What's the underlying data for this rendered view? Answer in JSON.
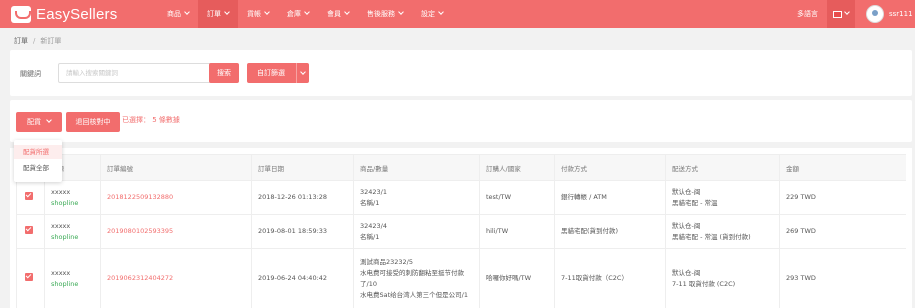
{
  "brand": {
    "name": "EasySellers",
    "accent": "#f26d6d"
  },
  "nav": {
    "items": [
      {
        "label": "商品",
        "active": false
      },
      {
        "label": "訂單",
        "active": true
      },
      {
        "label": "貨帳",
        "active": false
      },
      {
        "label": "倉庫",
        "active": false
      },
      {
        "label": "會員",
        "active": false
      },
      {
        "label": "售後服務",
        "active": false
      },
      {
        "label": "設定",
        "active": false
      }
    ],
    "lang": "多語言",
    "username": "ssr111"
  },
  "breadcrumb": {
    "parent": "訂單",
    "current": "新訂單"
  },
  "search": {
    "label": "關鍵詞",
    "placeholder": "請輸入搜索關鍵詞",
    "value": "",
    "search_button": "搜索",
    "filter_button": "自訂篩選"
  },
  "actions": {
    "dispatch_button": "配貨",
    "back_button": "退回核對中",
    "selected_text": "已選擇： 5 條數據",
    "dropdown": {
      "items": [
        "配貨所選",
        "配貨全部"
      ]
    }
  },
  "table": {
    "columns": [
      "",
      "來源",
      "訂單編號",
      "訂單日期",
      "商品/數量",
      "訂購人/國家",
      "付款方式",
      "配送方式",
      "金額"
    ],
    "rows": [
      {
        "src_label": "xxxxx",
        "src_store": "shopline",
        "order_no": "2018122509132880",
        "date": "2018-12-26 01:13:28",
        "products": [
          "32423/1",
          "名稱/1"
        ],
        "buyer": "test/TW",
        "payment": "銀行轉帳 / ATM",
        "shipping": [
          "默认仓-闽",
          "黑貓宅配 - 常溫"
        ],
        "amount": "229 TWD"
      },
      {
        "src_label": "xxxxx",
        "src_store": "shopline",
        "order_no": "2019080102593395",
        "date": "2019-08-01 18:59:33",
        "products": [
          "32423/4",
          "名稱/1"
        ],
        "buyer": "hili/TW",
        "payment": "黑貓宅配(貨到付款)",
        "shipping": [
          "默认仓-闽",
          "黑貓宅配 - 常溫 (貨到付款)"
        ],
        "amount": "269 TWD"
      },
      {
        "src_label": "xxxxx",
        "src_store": "shopline",
        "order_no": "2019062312404272",
        "date": "2019-06-24 04:40:42",
        "products": [
          "測試商品23232/5",
          "水电费可接受的刺防翻粘至挺节付款了/10",
          "水电费Sat给台湾人第三个但是公司/1"
        ],
        "buyer": "哈囉你好嗎/TW",
        "payment": "7-11取貨付款（C2C）",
        "shipping": [
          "默认仓-闽",
          "7-11 取貨付款 (C2C)"
        ],
        "amount": "293 TWD"
      }
    ]
  }
}
